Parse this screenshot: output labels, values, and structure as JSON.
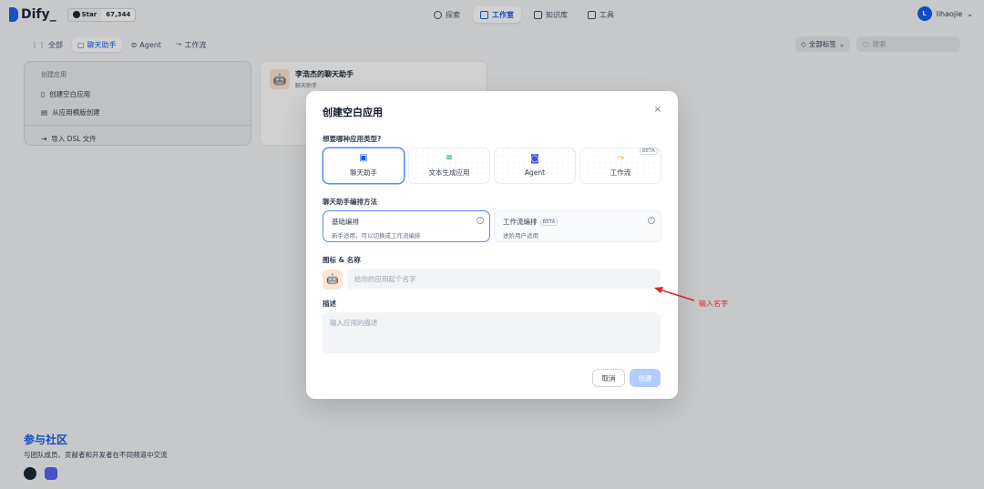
{
  "header": {
    "brand": "Dify_",
    "github": {
      "label": "Star",
      "count": "67,344"
    },
    "nav": [
      {
        "label": "探索",
        "icon": "compass-icon"
      },
      {
        "label": "工作室",
        "icon": "robot-icon",
        "active": true
      },
      {
        "label": "知识库",
        "icon": "book-icon"
      },
      {
        "label": "工具",
        "icon": "toolbox-icon"
      }
    ],
    "user": {
      "initial": "L",
      "name": "lihaojie"
    }
  },
  "filters": {
    "tabs": [
      {
        "label": "全部",
        "icon": "grid-icon"
      },
      {
        "label": "聊天助手",
        "icon": "chat-icon",
        "active": true
      },
      {
        "label": "Agent",
        "icon": "agent-icon"
      },
      {
        "label": "工作流",
        "icon": "workflow-icon"
      }
    ],
    "tag_select": "全部标签",
    "search_placeholder": "搜索"
  },
  "create_card": {
    "title": "创建应用",
    "items": [
      "创建空白应用",
      "从应用模版创建"
    ],
    "import": "导入 DSL 文件"
  },
  "app_card": {
    "name": "李浩杰的聊天助手",
    "type": "聊天助手"
  },
  "community": {
    "title": "参与社区",
    "subtitle": "与团队成员、贡献者和开发者在不同频道中交流"
  },
  "modal": {
    "title": "创建空白应用",
    "close": "×",
    "type_question": "想要哪种应用类型?",
    "types": [
      {
        "label": "聊天助手",
        "icon": "chat-bot-icon"
      },
      {
        "label": "文本生成应用",
        "icon": "text-gen-icon"
      },
      {
        "label": "Agent",
        "icon": "agent-icon"
      },
      {
        "label": "工作流",
        "icon": "workflow-icon",
        "badge": "BETA"
      }
    ],
    "mode_label": "聊天助手编排方法",
    "modes": [
      {
        "title": "基础编排",
        "desc": "新手适用，可以切换成工作流编排"
      },
      {
        "title": "工作流编排",
        "badge": "BETA",
        "desc": "进阶用户适用"
      }
    ],
    "name_label": "图标 & 名称",
    "name_placeholder": "给你的应用起个名字",
    "desc_label": "描述",
    "desc_placeholder": "输入应用的描述",
    "cancel": "取消",
    "create": "创建"
  },
  "annotation": {
    "text": "输入名字",
    "color": "#e02424"
  }
}
